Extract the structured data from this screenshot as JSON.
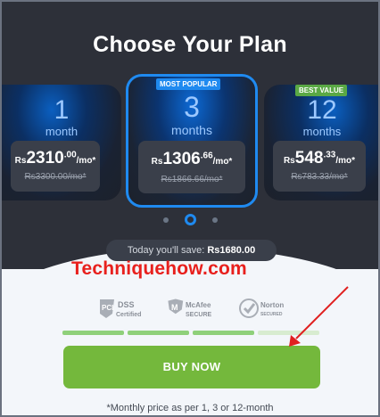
{
  "header": {
    "title": "Choose Your Plan"
  },
  "plans": [
    {
      "number": "1",
      "unit": "month",
      "currency": "Rs",
      "price_int": "2310",
      "price_dec": ".00",
      "per": "/mo*",
      "old_price": "Rs3300.00/mo*",
      "badge": ""
    },
    {
      "number": "3",
      "unit": "months",
      "currency": "Rs",
      "price_int": "1306",
      "price_dec": ".66",
      "per": "/mo*",
      "old_price": "Rs1866.66/mo*",
      "badge": "MOST POPULAR"
    },
    {
      "number": "12",
      "unit": "months",
      "currency": "Rs",
      "price_int": "548",
      "price_dec": ".33",
      "per": "/mo*",
      "old_price": "Rs783.33/mo*",
      "badge": "BEST VALUE"
    }
  ],
  "carousel": {
    "active_index": 1,
    "count": 3
  },
  "savings": {
    "label": "Today you'll save:",
    "amount": "Rs1680.00"
  },
  "watermark": "Techniquehow.com",
  "seals": {
    "pci": {
      "main": "PCI",
      "sub1": "DSS",
      "sub2": "Certified"
    },
    "mcafee": {
      "main": "McAfee",
      "sub": "SECURE"
    },
    "norton": {
      "main": "Norton",
      "sub": "SECURED"
    }
  },
  "progress": {
    "filled_segments": 3,
    "total_segments": 4
  },
  "cta": {
    "label": "BUY NOW"
  },
  "footer": {
    "note": "*Monthly price as per 1, 3 or 12-month"
  },
  "colors": {
    "dark_bg": "#2d3039",
    "accent_blue": "#1f8af0",
    "buy_green": "#74b83c",
    "watermark_red": "#e8201d",
    "badge_blue": "#1f8af0",
    "badge_green": "#5aa845"
  }
}
